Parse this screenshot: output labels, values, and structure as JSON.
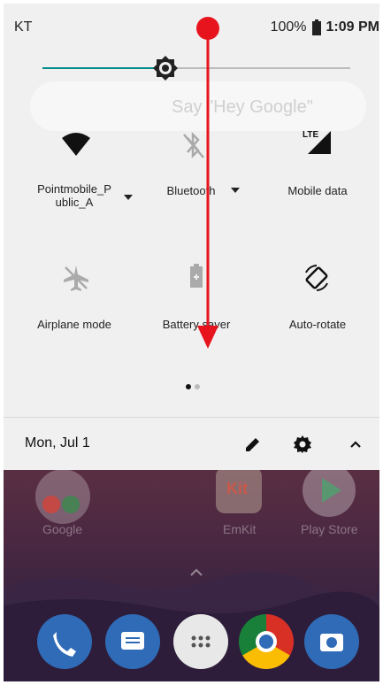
{
  "status_bar": {
    "carrier": "KT",
    "battery": "100%",
    "time": "1:09 PM"
  },
  "brightness": {
    "level": 0.4,
    "track_color": "#008b8b"
  },
  "background_search_hint": "Say \"Hey Google\"",
  "tiles": [
    {
      "label": "Pointmobile_P",
      "label2": "ublic_A",
      "icon": "wifi-icon",
      "has_dropdown": true
    },
    {
      "label": "Bluetooth",
      "icon": "bluetooth-off-icon",
      "has_dropdown": true
    },
    {
      "label": "Mobile data",
      "icon": "lte-signal-icon",
      "badge": "LTE",
      "has_dropdown": false
    },
    {
      "label": "Airplane mode",
      "icon": "airplane-off-icon",
      "has_dropdown": false
    },
    {
      "label": "Battery saver",
      "icon": "battery-saver-icon",
      "has_dropdown": false
    },
    {
      "label": "Auto-rotate",
      "icon": "auto-rotate-icon",
      "has_dropdown": false
    }
  ],
  "page_indicator": {
    "pages": 2,
    "current": 1
  },
  "footer": {
    "date": "Mon, Jul 1",
    "icons": [
      "edit-icon",
      "settings-icon",
      "collapse-chevron-icon"
    ]
  },
  "home_screen": {
    "apps_row": [
      {
        "label": "Google",
        "icon": "google-folder-icon"
      },
      {
        "label": "EmKit",
        "icon": "emkit-icon",
        "badge": "Kit"
      },
      {
        "label": "Play Store",
        "icon": "play-store-icon"
      }
    ],
    "dock": [
      "phone-icon",
      "messages-icon",
      "app-drawer-icon",
      "chrome-icon",
      "camera-icon"
    ]
  },
  "annotation": {
    "type": "swipe-down-arrow",
    "color": "#e8141d"
  }
}
